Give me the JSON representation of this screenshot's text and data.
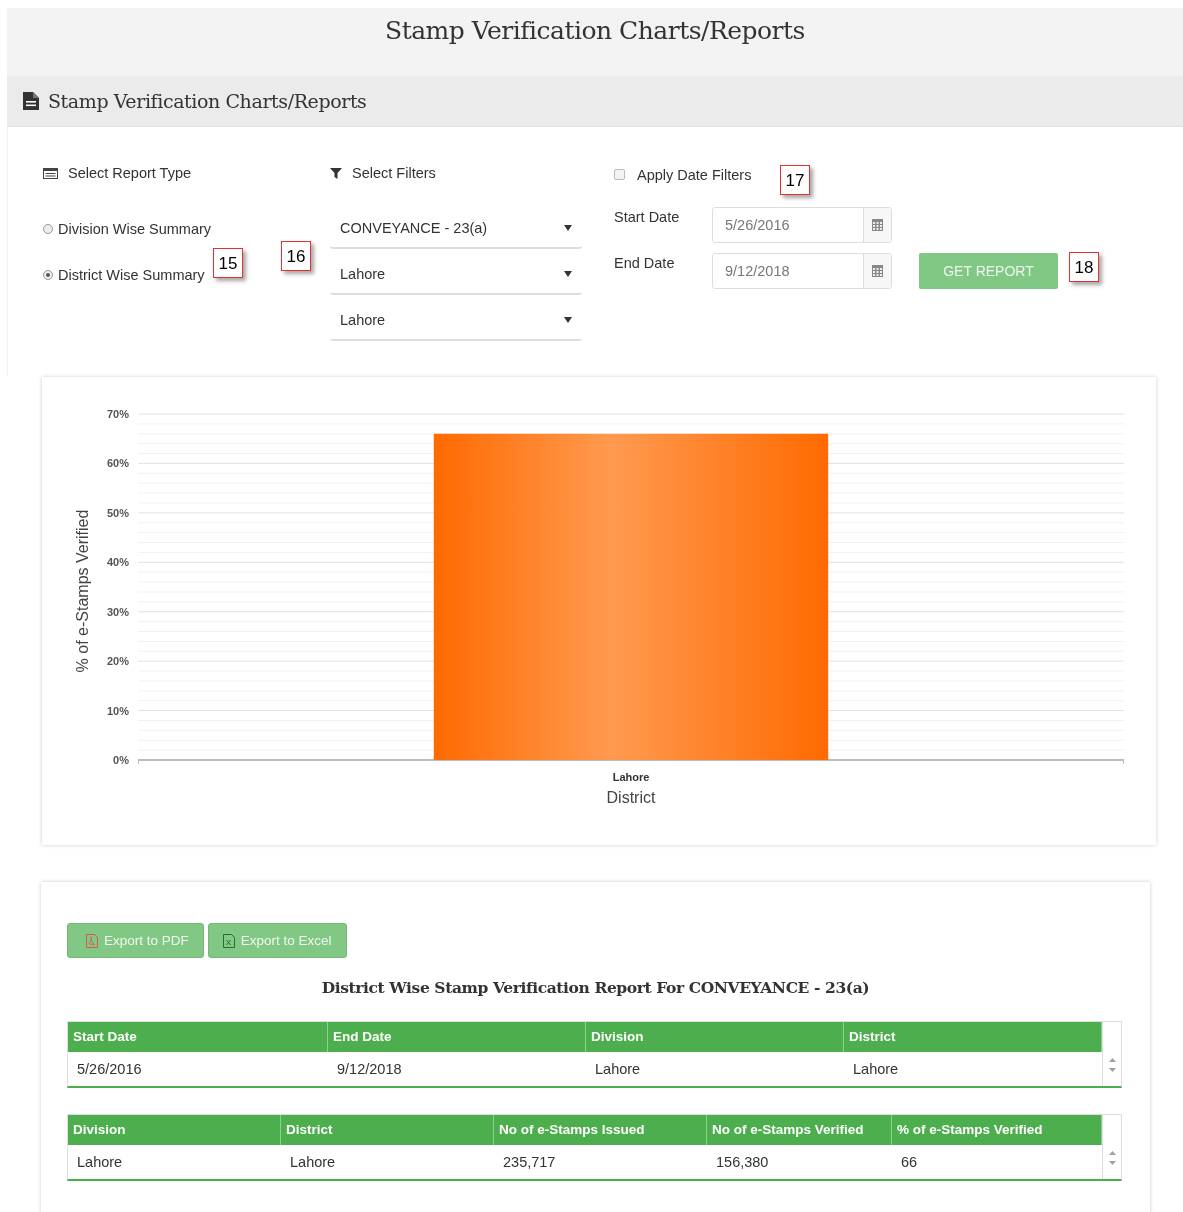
{
  "page_title": "Stamp Verification Charts/Reports",
  "panel": {
    "title": "Stamp Verification Charts/Reports"
  },
  "report_type": {
    "label": "Select Report Type",
    "options": [
      {
        "label": "Division Wise Summary",
        "selected": false
      },
      {
        "label": "District Wise Summary",
        "selected": true,
        "callout": "15"
      }
    ]
  },
  "filters": {
    "label": "Select Filters",
    "selects": [
      {
        "value": "CONVEYANCE - 23(a)"
      },
      {
        "value": "Lahore",
        "callout": "16"
      },
      {
        "value": "Lahore"
      }
    ]
  },
  "date_filters": {
    "label": "Apply Date Filters",
    "checked": false,
    "callout": "17",
    "start_label": "Start Date",
    "start_value": "5/26/2016",
    "end_label": "End Date",
    "end_value": "9/12/2018"
  },
  "get_report": {
    "label": "GET REPORT",
    "callout": "18"
  },
  "chart": {
    "chart_data": {
      "type": "bar",
      "xlabel": "District",
      "ylabel": "% of e-Stamps Verified",
      "categories": [
        "Lahore"
      ],
      "grid": true,
      "series": [
        {
          "color": "#ff6a00",
          "values": [
            66
          ]
        }
      ],
      "ylim": [
        0,
        70
      ],
      "yticks": [
        {
          "value": 0,
          "label": "0%"
        },
        {
          "value": 10,
          "label": "10%"
        },
        {
          "value": 20,
          "label": "20%"
        },
        {
          "value": 30,
          "label": "30%"
        },
        {
          "value": 40,
          "label": "40%"
        },
        {
          "value": 50,
          "label": "50%"
        },
        {
          "value": 60,
          "label": "60%"
        },
        {
          "value": 70,
          "label": "70%"
        }
      ]
    }
  },
  "report": {
    "buttons": [
      {
        "label": "Export to PDF",
        "kind": "pdf"
      },
      {
        "label": "Export to Excel",
        "kind": "excel"
      }
    ],
    "title": "District Wise Stamp Verification Report For CONVEYANCE - 23(a)",
    "tables": [
      {
        "columns": [
          "Start Date",
          "End Date",
          "Division",
          "District"
        ],
        "rows": [
          [
            "5/26/2016",
            "9/12/2018",
            "Lahore",
            "Lahore"
          ]
        ]
      },
      {
        "columns": [
          "Division",
          "District",
          "No of e-Stamps Issued",
          "No of e-Stamps Verified",
          "% of e-Stamps Verified"
        ],
        "rows": [
          [
            "Lahore",
            "Lahore",
            "235,717",
            "156,380",
            "66"
          ]
        ]
      }
    ]
  }
}
